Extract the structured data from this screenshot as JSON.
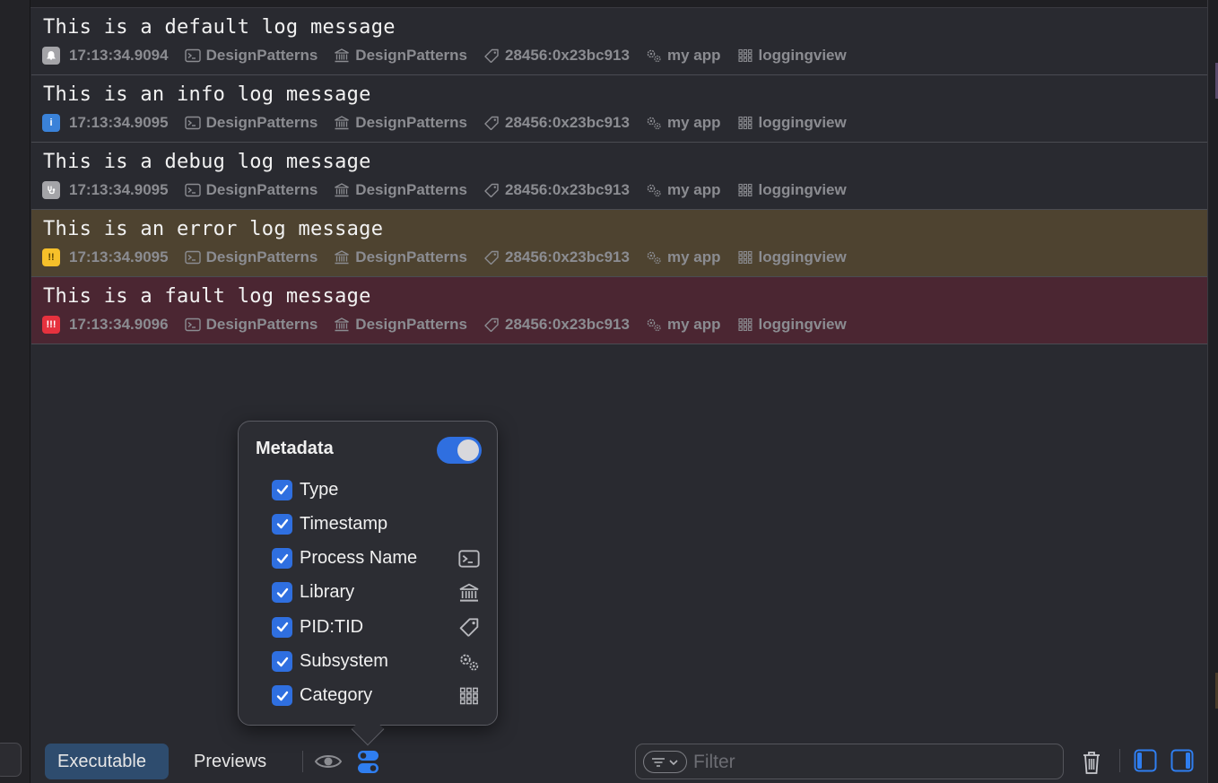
{
  "logs": [
    {
      "message": "This is a default log message",
      "type": "default",
      "badge": "",
      "timestamp": "17:13:34.9094",
      "process": "DesignPatterns",
      "library": "DesignPatterns",
      "pid_tid": "28456:0x23bc913",
      "subsystem": "my app",
      "category": "loggingview"
    },
    {
      "message": "This is an info log message",
      "type": "info",
      "badge": "i",
      "timestamp": "17:13:34.9095",
      "process": "DesignPatterns",
      "library": "DesignPatterns",
      "pid_tid": "28456:0x23bc913",
      "subsystem": "my app",
      "category": "loggingview"
    },
    {
      "message": "This is a debug log message",
      "type": "debug",
      "badge": "",
      "timestamp": "17:13:34.9095",
      "process": "DesignPatterns",
      "library": "DesignPatterns",
      "pid_tid": "28456:0x23bc913",
      "subsystem": "my app",
      "category": "loggingview"
    },
    {
      "message": "This is an error log message",
      "type": "error",
      "badge": "!!",
      "timestamp": "17:13:34.9095",
      "process": "DesignPatterns",
      "library": "DesignPatterns",
      "pid_tid": "28456:0x23bc913",
      "subsystem": "my app",
      "category": "loggingview"
    },
    {
      "message": "This is a fault log message",
      "type": "fault",
      "badge": "!!!",
      "timestamp": "17:13:34.9096",
      "process": "DesignPatterns",
      "library": "DesignPatterns",
      "pid_tid": "28456:0x23bc913",
      "subsystem": "my app",
      "category": "loggingview"
    }
  ],
  "metadata_popover": {
    "title": "Metadata",
    "enabled": true,
    "options": [
      {
        "label": "Type",
        "checked": true,
        "icon": ""
      },
      {
        "label": "Timestamp",
        "checked": true,
        "icon": ""
      },
      {
        "label": "Process Name",
        "checked": true,
        "icon": "terminal-icon"
      },
      {
        "label": "Library",
        "checked": true,
        "icon": "library-icon"
      },
      {
        "label": "PID:TID",
        "checked": true,
        "icon": "tag-icon"
      },
      {
        "label": "Subsystem",
        "checked": true,
        "icon": "gears-icon"
      },
      {
        "label": "Category",
        "checked": true,
        "icon": "grid-icon"
      }
    ]
  },
  "bottom_bar": {
    "executable_label": "Executable",
    "previews_label": "Previews",
    "filter_placeholder": "Filter"
  },
  "colors": {
    "accent": "#2f6fe0",
    "error_row": "#4e4330",
    "fault_row": "#4b2632",
    "background": "#292a30"
  }
}
